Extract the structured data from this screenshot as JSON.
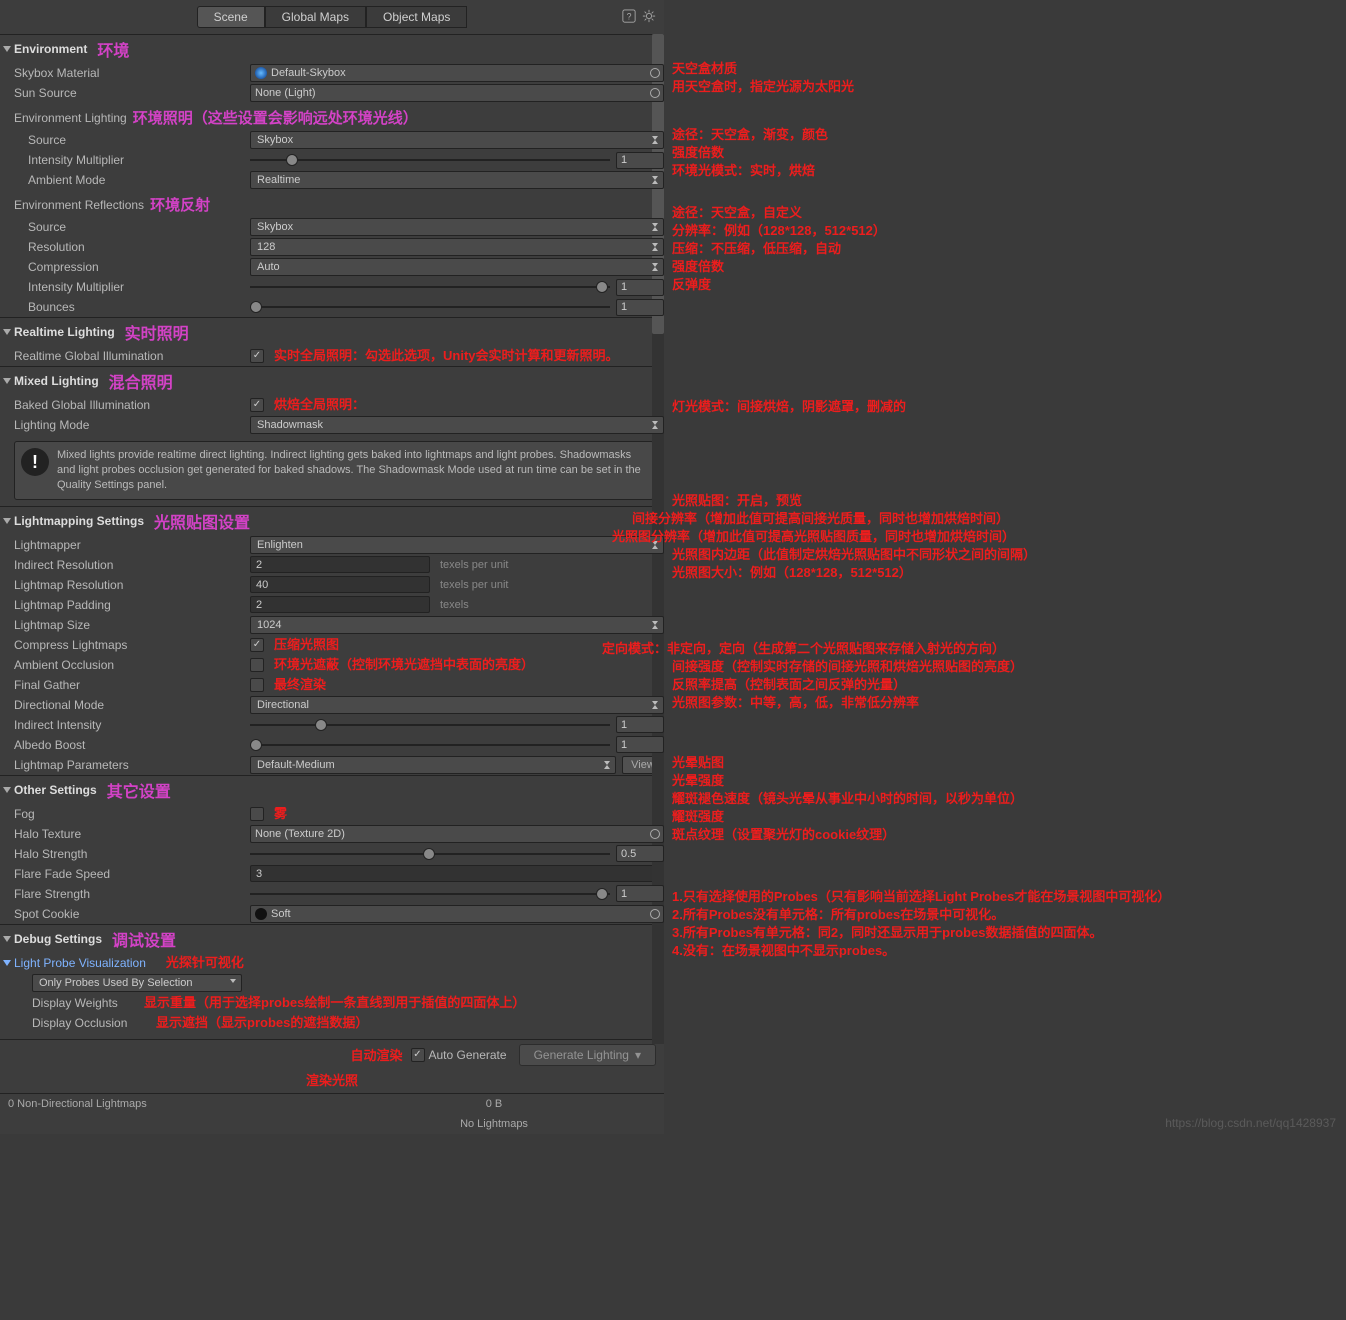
{
  "tabs": {
    "scene": "Scene",
    "global_maps": "Global Maps",
    "object_maps": "Object Maps"
  },
  "sections": {
    "env": {
      "title": "Environment",
      "anno": "环境"
    },
    "env_light": {
      "title": "Environment Lighting",
      "anno": "环境照明（这些设置会影响远处环境光线）"
    },
    "env_refl": {
      "title": "Environment Reflections",
      "anno": "环境反射"
    },
    "realtime": {
      "title": "Realtime Lighting",
      "anno": "实时照明"
    },
    "mixed": {
      "title": "Mixed Lighting",
      "anno": "混合照明"
    },
    "lmset": {
      "title": "Lightmapping Settings",
      "anno": "光照贴图设置"
    },
    "other": {
      "title": "Other Settings",
      "anno": "其它设置"
    },
    "debug": {
      "title": "Debug Settings",
      "anno": "调试设置"
    }
  },
  "labels": {
    "skybox_material": "Skybox Material",
    "sun_source": "Sun Source",
    "source": "Source",
    "intensity_multiplier": "Intensity Multiplier",
    "ambient_mode": "Ambient Mode",
    "resolution": "Resolution",
    "compression": "Compression",
    "bounces": "Bounces",
    "realtime_gi": "Realtime Global Illumination",
    "baked_gi": "Baked Global Illumination",
    "lighting_mode": "Lighting Mode",
    "lightmapper": "Lightmapper",
    "indirect_res": "Indirect Resolution",
    "lightmap_res": "Lightmap Resolution",
    "lightmap_pad": "Lightmap Padding",
    "lightmap_size": "Lightmap Size",
    "compress_lm": "Compress Lightmaps",
    "ao": "Ambient Occlusion",
    "final_gather": "Final Gather",
    "directional_mode": "Directional Mode",
    "indirect_intensity": "Indirect Intensity",
    "albedo_boost": "Albedo Boost",
    "lm_params": "Lightmap Parameters",
    "fog": "Fog",
    "halo_tex": "Halo Texture",
    "halo_strength": "Halo Strength",
    "flare_fade": "Flare Fade Speed",
    "flare_strength": "Flare Strength",
    "spot_cookie": "Spot Cookie",
    "lpv": "Light Probe Visualization",
    "display_weights": "Display Weights",
    "display_occlusion": "Display Occlusion",
    "auto_generate": "Auto Generate",
    "generate_lighting": "Generate Lighting",
    "view": "View"
  },
  "values": {
    "skybox_material": "Default-Skybox",
    "sun_source": "None (Light)",
    "env_light_source": "Skybox",
    "env_light_intensity": "1",
    "ambient_mode": "Realtime",
    "env_refl_source": "Skybox",
    "env_refl_res": "128",
    "env_refl_comp": "Auto",
    "env_refl_intensity": "1",
    "bounces": "1",
    "lighting_mode": "Shadowmask",
    "lightmapper": "Enlighten",
    "indirect_res": "2",
    "lightmap_res": "40",
    "lightmap_pad": "2",
    "lightmap_size": "1024",
    "directional_mode": "Directional",
    "indirect_intensity": "1",
    "albedo_boost": "1",
    "lm_params": "Default-Medium",
    "halo_tex": "None (Texture 2D)",
    "halo_strength": "0.5",
    "flare_fade": "3",
    "flare_strength": "1",
    "spot_cookie": "Soft",
    "lpv_dropdown": "Only Probes Used By Selection",
    "status1": "0 Non-Directional Lightmaps",
    "status2": "0 B",
    "status3": "No Lightmaps"
  },
  "units": {
    "texels_per_unit": "texels per unit",
    "texels": "texels"
  },
  "infobox": "Mixed lights provide realtime direct lighting. Indirect lighting gets baked into lightmaps and light probes. Shadowmasks and light probes occlusion get generated for baked shadows. The Shadowmask Mode used at run time can be set in the Quality Settings panel.",
  "red": {
    "rtgi": "实时全局照明：勾选此选项，Unity会实时计算和更新照明。",
    "bgi": "烘焙全局照明：",
    "compress_lm": "压缩光照图",
    "ao": "环境光遮蔽（控制环境光遮挡中表面的亮度）",
    "final_gather": "最终渲染",
    "fog": "雾",
    "dw": "显示重量（用于选择probes绘制一条直线到用于插值的四面体上）",
    "do": "显示遮挡（显示probes的遮挡数据）",
    "auto": "自动渲染",
    "gen": "渲染光照",
    "lpv": "光探针可视化"
  },
  "side": {
    "p1": "天空盒材质",
    "p2": "用天空盒时，指定光源为太阳光",
    "p3": "途径：天空盒，渐变，颜色",
    "p4": "强度倍数",
    "p5": "环境光模式：实时，烘焙",
    "p6": "途径：天空盒，自定义",
    "p7": "分辨率：例如（128*128，512*512）",
    "p8": "压缩：不压缩，低压缩，自动",
    "p9": "强度倍数",
    "p10": "反弹度",
    "p11": "灯光模式：间接烘焙，阴影遮罩，删减的",
    "p12": "光照贴图：开启，预览",
    "p13": "间接分辨率（增加此值可提高间接光质量，同时也增加烘焙时间）",
    "p14": "光照图分辨率（增加此值可提高光照贴图质量，同时也增加烘焙时间）",
    "p15": "光照图内边距（此值制定烘焙光照贴图中不同形状之间的间隔）",
    "p16": "光照图大小：例如（128*128，512*512）",
    "p17": "定向模式：非定向，定向（生成第二个光照贴图来存储入射光的方向）",
    "p18": "间接强度（控制实时存储的间接光照和烘焙光照贴图的亮度）",
    "p19": "反照率提高（控制表面之间反弹的光量）",
    "p20": "光照图参数：中等，高，低，非常低分辨率",
    "p21": "光晕贴图",
    "p22": "光晕强度",
    "p23": "耀斑褪色速度（镜头光晕从事业中小时的时间，以秒为单位）",
    "p24": "耀斑强度",
    "p25": "斑点纹理（设置聚光灯的cookie纹理）",
    "p26": "1.只有选择使用的Probes（只有影响当前选择Light Probes才能在场景视图中可视化）\n2.所有Probes没有单元格：所有probes在场景中可视化。\n3.所有Probes有单元格：同2，同时还显示用于probes数据插值的四面体。\n4.没有：在场景视图中不显示probes。"
  },
  "watermark": "https://blog.csdn.net/qq1428937"
}
